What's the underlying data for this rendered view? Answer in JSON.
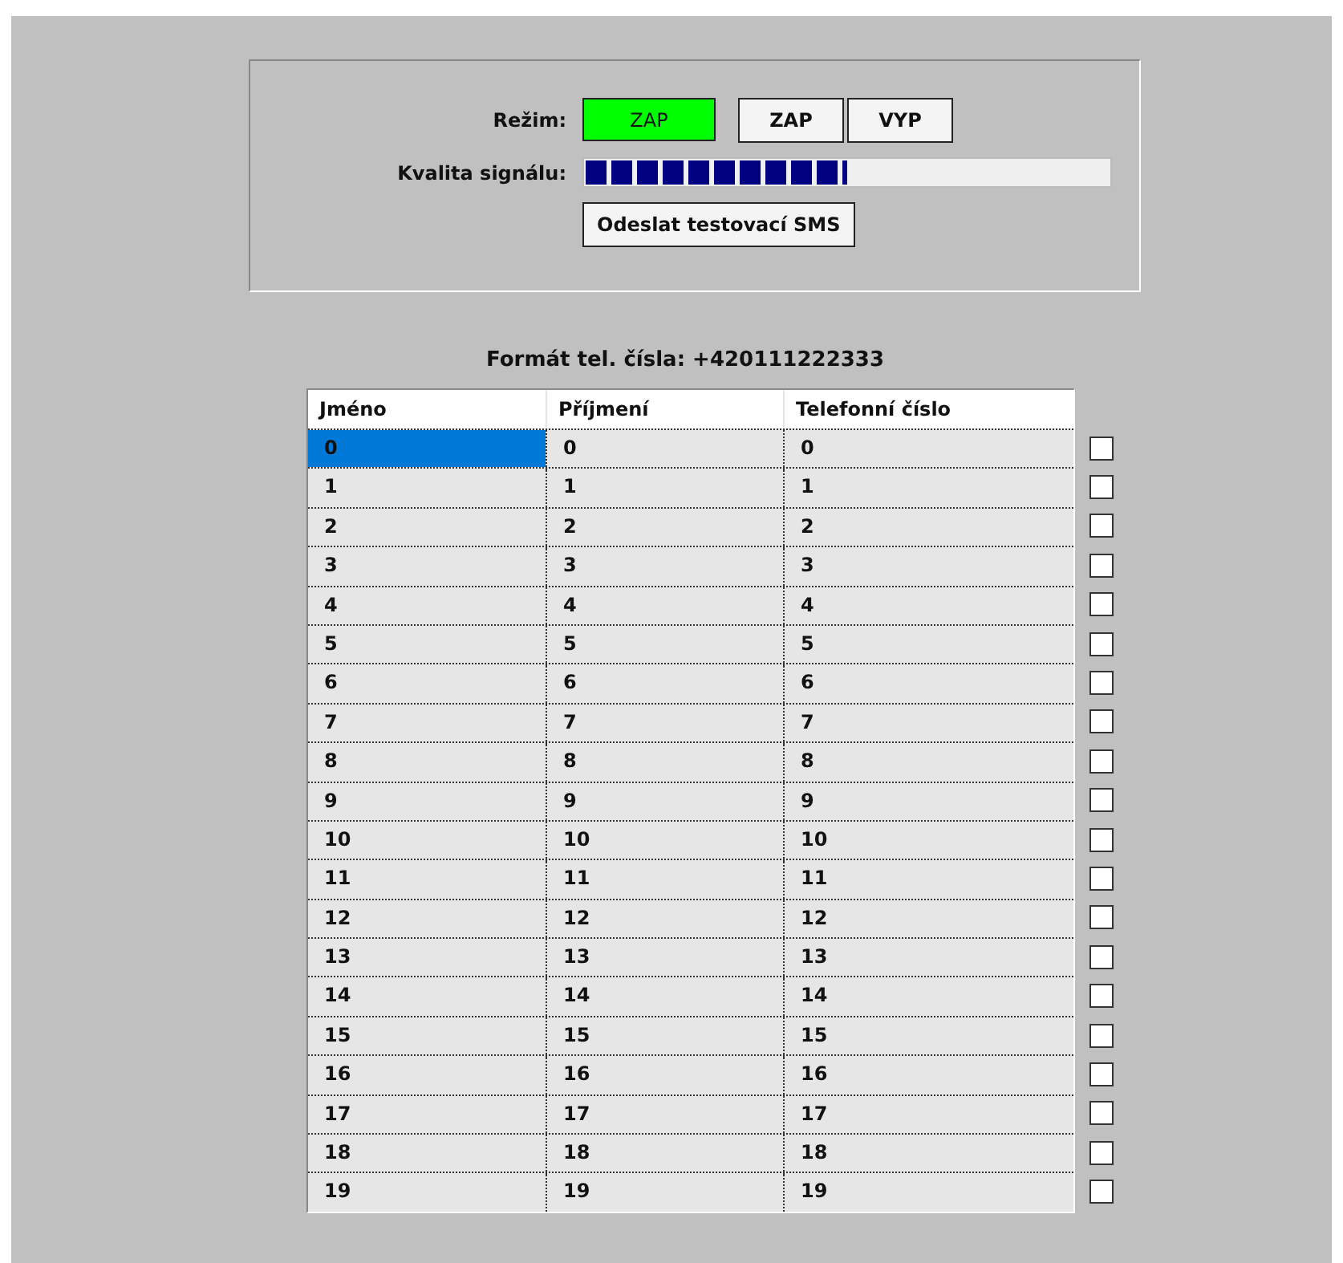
{
  "panel": {
    "mode_label": "Režim:",
    "indicator": {
      "text": "ZAP",
      "on": true
    },
    "mode_buttons": [
      "ZAP",
      "VYP"
    ],
    "signal_label": "Kvalita signálu:",
    "signal": {
      "level": 0.5
    },
    "test_button": "Odeslat testovací SMS"
  },
  "format_note": "Formát tel. čísla: +420111222333",
  "table": {
    "columns": [
      "Jméno",
      "Příjmení",
      "Telefonní číslo"
    ],
    "rows": [
      {
        "cells": [
          "0",
          "0",
          "0"
        ],
        "selected": true,
        "checked": false
      },
      {
        "cells": [
          "1",
          "1",
          "1"
        ],
        "selected": false,
        "checked": false
      },
      {
        "cells": [
          "2",
          "2",
          "2"
        ],
        "selected": false,
        "checked": false
      },
      {
        "cells": [
          "3",
          "3",
          "3"
        ],
        "selected": false,
        "checked": false
      },
      {
        "cells": [
          "4",
          "4",
          "4"
        ],
        "selected": false,
        "checked": false
      },
      {
        "cells": [
          "5",
          "5",
          "5"
        ],
        "selected": false,
        "checked": false
      },
      {
        "cells": [
          "6",
          "6",
          "6"
        ],
        "selected": false,
        "checked": false
      },
      {
        "cells": [
          "7",
          "7",
          "7"
        ],
        "selected": false,
        "checked": false
      },
      {
        "cells": [
          "8",
          "8",
          "8"
        ],
        "selected": false,
        "checked": false
      },
      {
        "cells": [
          "9",
          "9",
          "9"
        ],
        "selected": false,
        "checked": false
      },
      {
        "cells": [
          "10",
          "10",
          "10"
        ],
        "selected": false,
        "checked": false
      },
      {
        "cells": [
          "11",
          "11",
          "11"
        ],
        "selected": false,
        "checked": false
      },
      {
        "cells": [
          "12",
          "12",
          "12"
        ],
        "selected": false,
        "checked": false
      },
      {
        "cells": [
          "13",
          "13",
          "13"
        ],
        "selected": false,
        "checked": false
      },
      {
        "cells": [
          "14",
          "14",
          "14"
        ],
        "selected": false,
        "checked": false
      },
      {
        "cells": [
          "15",
          "15",
          "15"
        ],
        "selected": false,
        "checked": false
      },
      {
        "cells": [
          "16",
          "16",
          "16"
        ],
        "selected": false,
        "checked": false
      },
      {
        "cells": [
          "17",
          "17",
          "17"
        ],
        "selected": false,
        "checked": false
      },
      {
        "cells": [
          "18",
          "18",
          "18"
        ],
        "selected": false,
        "checked": false
      },
      {
        "cells": [
          "19",
          "19",
          "19"
        ],
        "selected": false,
        "checked": false
      }
    ]
  }
}
